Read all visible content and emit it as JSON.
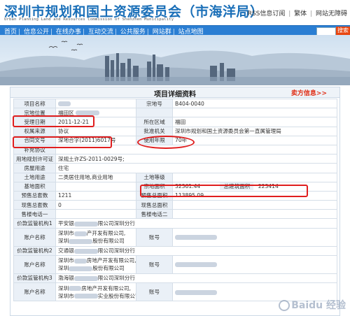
{
  "header": {
    "title": "深圳市规划和国土资源委员会（市海洋局）",
    "subtitle": "Urban Planning Land and Resources Commission of Shenzhen Municipality",
    "links": [
      "RSS信息订阅",
      "繁体",
      "网站无障碍"
    ]
  },
  "nav": {
    "items": [
      "首页",
      "信息公开",
      "在线办事",
      "互动交流",
      "公共服务",
      "网站群",
      "站点地图"
    ],
    "search_label": "搜索"
  },
  "card": {
    "title": "项目详细资料",
    "seller_link": "卖方信息>>"
  },
  "fields": {
    "project_name_label": "项目名称",
    "parcel_no_label": "宗地号",
    "parcel_no": "B404-0040",
    "location_label": "宗地位置",
    "location_value": "福田区",
    "accept_date_label": "受理日期",
    "accept_date": "2011-12-21",
    "district_label": "所在区域",
    "district": "福田",
    "rights_source_label": "权属来源",
    "rights_source": "协议",
    "approval_org_label": "批准机关",
    "approval_org": "深圳市规划和国土资源委员会第一直属管理局",
    "contract_no_label": "合同文号",
    "contract_no": "深地合字(2011)6017号",
    "years_label": "使用年限",
    "years": "70年",
    "supp_label": "补充协议",
    "permit_label": "用地规划许可证",
    "permit": "深规土许ZS-2011-0029号;",
    "house_use_label": "房屋用途",
    "house_use": "住宅",
    "land_use_label": "土地用途",
    "land_use": "二类居住用地,商业用地",
    "land_grade_label": "土地等级",
    "base_area_label": "基地面积",
    "parcel_area_label": "宗地面积",
    "parcel_area": "32361.44",
    "total_area_label": "总建筑面积",
    "total_area": "223414",
    "presale_units_label": "预售总套数",
    "presale_units": "1211",
    "presale_area_label": "预售总面积",
    "presale_area": "113895.09",
    "spot_units_label": "现售总套数",
    "spot_units": "0",
    "spot_area_label": "现售总面积",
    "phone1_label": "售楼电话一",
    "phone2_label": "售楼电话二",
    "fund_org1_label": "价款监管机构1",
    "fund_org1_a": "平安银",
    "fund_org1_b": "限公司深圳分行",
    "account_name_label": "账户名称",
    "acct1_a": "深圳市",
    "acct1_b": "产开发有限公司,",
    "acct1_c": "深圳",
    "acct1_d": "股份有限公司",
    "account_no_label": "账号",
    "fund_org2_label": "价款监管机构2",
    "fund_org2_a": "交通银",
    "fund_org2_b": "限公司深圳分行",
    "acct2_a": "深圳市",
    "acct2_b": "房地产开发有限公司,",
    "acct2_c": "深圳",
    "acct2_d": "股份有限公司",
    "fund_org3_label": "价款监管机构3",
    "fund_org3_a": "渤海银",
    "fund_org3_b": "限公司深圳分行",
    "acct3_a": "深圳",
    "acct3_b": "房地产开发有限公司,",
    "acct3_c": "深圳市",
    "acct3_d": "实业股份有限公司"
  },
  "watermark": "Baidu 经验",
  "colors": {
    "brand_blue": "#1a6fb8",
    "nav_blue": "#2a7ed3",
    "annotation_red": "#e01e1e",
    "seller_red": "#e03018"
  }
}
